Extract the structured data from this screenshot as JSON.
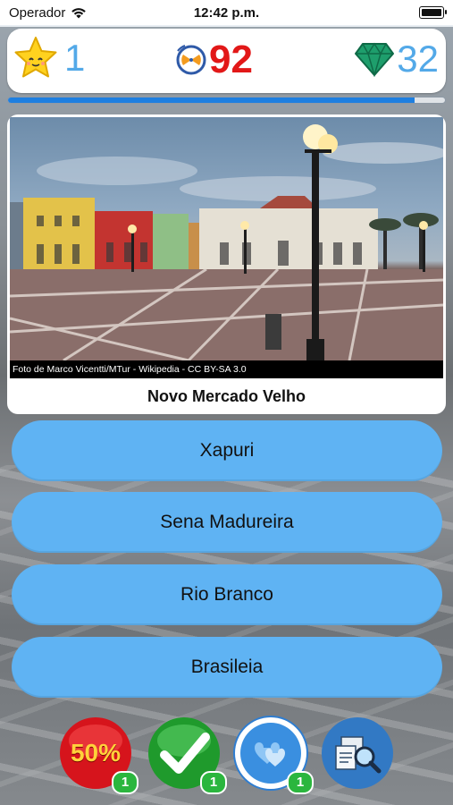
{
  "status_bar": {
    "carrier": "Operador",
    "time": "12:42 p.m."
  },
  "score": {
    "stars": "1",
    "points": "92",
    "gems": "32"
  },
  "progress": {
    "fraction": 0.93
  },
  "photo": {
    "credit": "Foto de Marco Vicentti/MTur - Wikipedia - CC BY-SA 3.0",
    "caption": "Novo Mercado Velho"
  },
  "answers": [
    "Xapuri",
    "Sena Madureira",
    "Rio Branco",
    "Brasileia"
  ],
  "powerups": {
    "fifty": {
      "label": "50%",
      "count": "1"
    },
    "check": {
      "count": "1"
    },
    "heart": {
      "count": "1"
    }
  },
  "colors": {
    "accent": "#5fb3f3",
    "score_red": "#e21818",
    "progress": "#1e7fe0"
  }
}
